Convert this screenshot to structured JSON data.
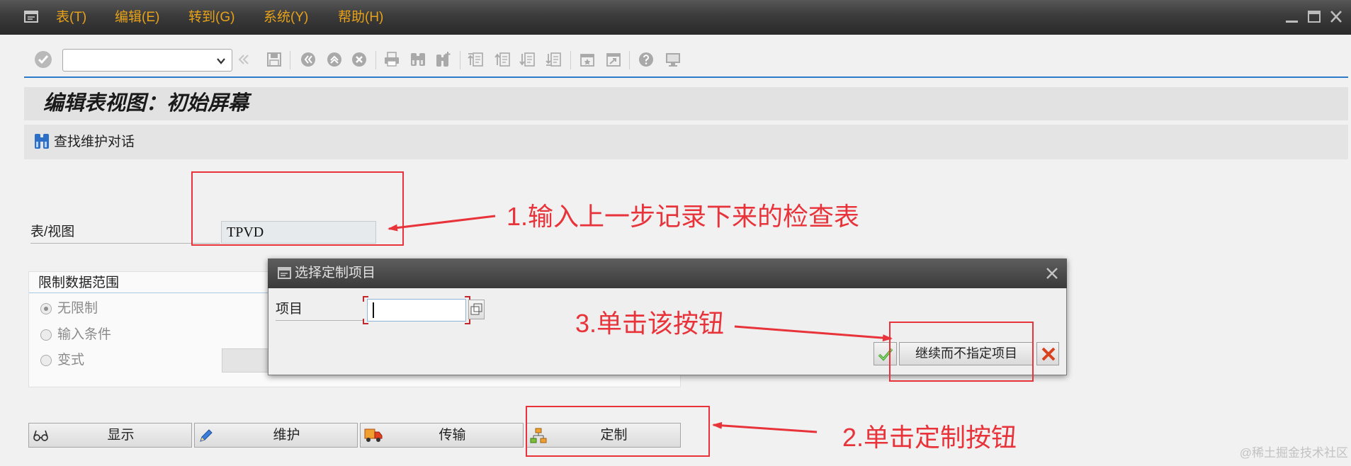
{
  "menu": {
    "items": [
      "表(T)",
      "编辑(E)",
      "转到(G)",
      "系统(Y)",
      "帮助(H)"
    ],
    "color": "#e8a21a"
  },
  "toolbar": {
    "command_field_value": "",
    "icons": [
      "back-double-icon",
      "save-icon",
      "back-icon",
      "exit-icon",
      "cancel-icon",
      "print-icon",
      "find-icon",
      "find-next-icon",
      "first-page-icon",
      "previous-page-icon",
      "next-page-icon",
      "last-page-icon",
      "create-session-icon",
      "generate-shortcut-icon",
      "help-icon",
      "customize-layout-icon"
    ]
  },
  "title": "编辑表视图：初始屏幕",
  "app_toolbar": {
    "find_label": "查找维护对话",
    "find_icon": "binoculars-icon"
  },
  "form": {
    "table_view_label": "表/视图",
    "table_view_value": "TPVD",
    "restrict_group": {
      "title": "限制数据范围",
      "options": [
        {
          "label": "无限制",
          "selected": true
        },
        {
          "label": "输入条件",
          "selected": false
        },
        {
          "label": "变式",
          "selected": false
        }
      ]
    }
  },
  "actions": [
    {
      "label": "显示",
      "icon": "display-icon"
    },
    {
      "label": "维护",
      "icon": "edit-icon"
    },
    {
      "label": "传输",
      "icon": "transport-icon"
    },
    {
      "label": "定制",
      "icon": "customizing-icon"
    }
  ],
  "dialog": {
    "title": "选择定制项目",
    "field_label": "项目",
    "field_value": "",
    "continue_label": "继续而不指定项目"
  },
  "annotations": {
    "step1": "1.输入上一步记录下来的检查表",
    "step2": "2.单击定制按钮",
    "step3": "3.单击该按钮",
    "color": "#e8333a"
  },
  "watermark": "@稀土掘金技术社区"
}
